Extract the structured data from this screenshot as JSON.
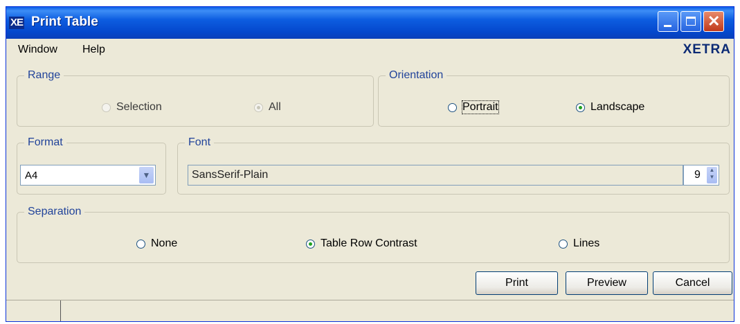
{
  "window": {
    "title": "Print Table",
    "app_icon_text": "XE"
  },
  "menu": {
    "items": [
      "Window",
      "Help"
    ],
    "brand": "XETRA"
  },
  "range": {
    "legend": "Range",
    "options": [
      {
        "label": "Selection",
        "selected": false,
        "enabled": false
      },
      {
        "label": "All",
        "selected": true,
        "enabled": false
      }
    ]
  },
  "orientation": {
    "legend": "Orientation",
    "options": [
      {
        "label": "Portrait",
        "selected": false
      },
      {
        "label": "Landscape",
        "selected": true
      }
    ]
  },
  "format": {
    "legend": "Format",
    "value": "A4"
  },
  "font": {
    "legend": "Font",
    "value": "SansSerif-Plain",
    "size": "9"
  },
  "separation": {
    "legend": "Separation",
    "options": [
      {
        "label": "None",
        "selected": false
      },
      {
        "label": "Table Row Contrast",
        "selected": true
      },
      {
        "label": "Lines",
        "selected": false
      }
    ]
  },
  "buttons": {
    "print": "Print",
    "preview": "Preview",
    "cancel": "Cancel"
  },
  "colors": {
    "titlebar": "#0a5ce8",
    "window_bg": "#ece9d8",
    "legend_text": "#21439a",
    "brand": "#0b2a74"
  },
  "icons": {
    "minimize": "minimize-icon",
    "maximize": "maximize-icon",
    "close": "close-icon",
    "dropdown": "chevron-down-icon",
    "spinner": "spinner-arrows-icon"
  }
}
